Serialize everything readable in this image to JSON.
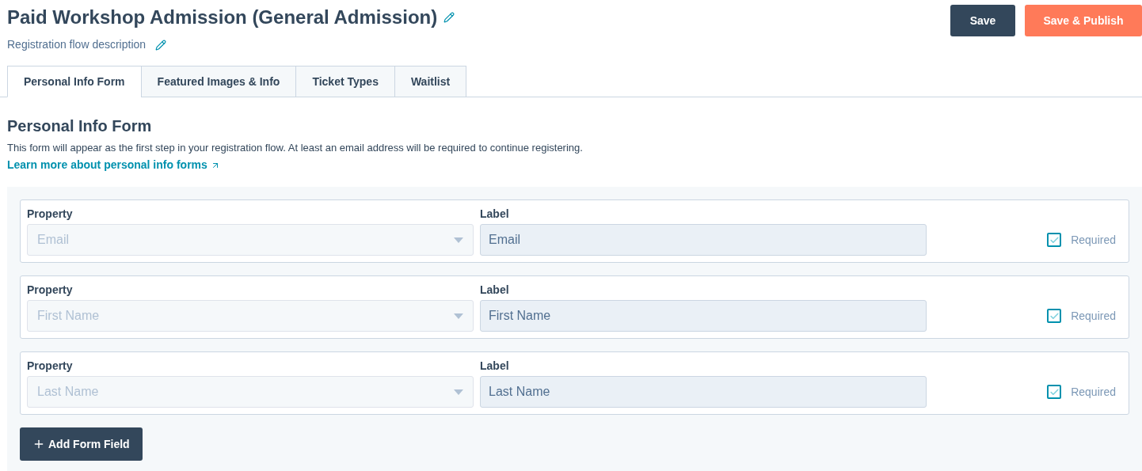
{
  "header": {
    "title": "Paid Workshop Admission (General Admission)",
    "description": "Registration flow description"
  },
  "buttons": [
    {
      "label": "Save",
      "kind": "secondary"
    },
    {
      "label": "Save & Publish",
      "kind": "primary"
    }
  ],
  "tabs": [
    {
      "label": "Personal Info Form",
      "selected": true
    },
    {
      "label": "Featured Images & Info",
      "selected": false
    },
    {
      "label": "Ticket Types",
      "selected": false
    },
    {
      "label": "Waitlist",
      "selected": false
    }
  ],
  "section": {
    "title": "Personal Info Form",
    "description": "This form will appear as the first step in your registration flow. At least an email address will be required to continue registering.",
    "link": "Learn more about personal info forms"
  },
  "fields": [
    {
      "property_label": "Property",
      "property": "Email",
      "property_disabled": true,
      "label_label": "Label",
      "label": "Email",
      "required": true,
      "required_label": "Required"
    },
    {
      "property_label": "Property",
      "property": "First Name",
      "property_disabled": true,
      "label_label": "Label",
      "label": "First Name",
      "required": true,
      "required_label": "Required"
    },
    {
      "property_label": "Property",
      "property": "Last Name",
      "property_disabled": true,
      "label_label": "Label",
      "label": "Last Name",
      "required": true,
      "required_label": "Required"
    }
  ],
  "add_button": "Add Form Field"
}
